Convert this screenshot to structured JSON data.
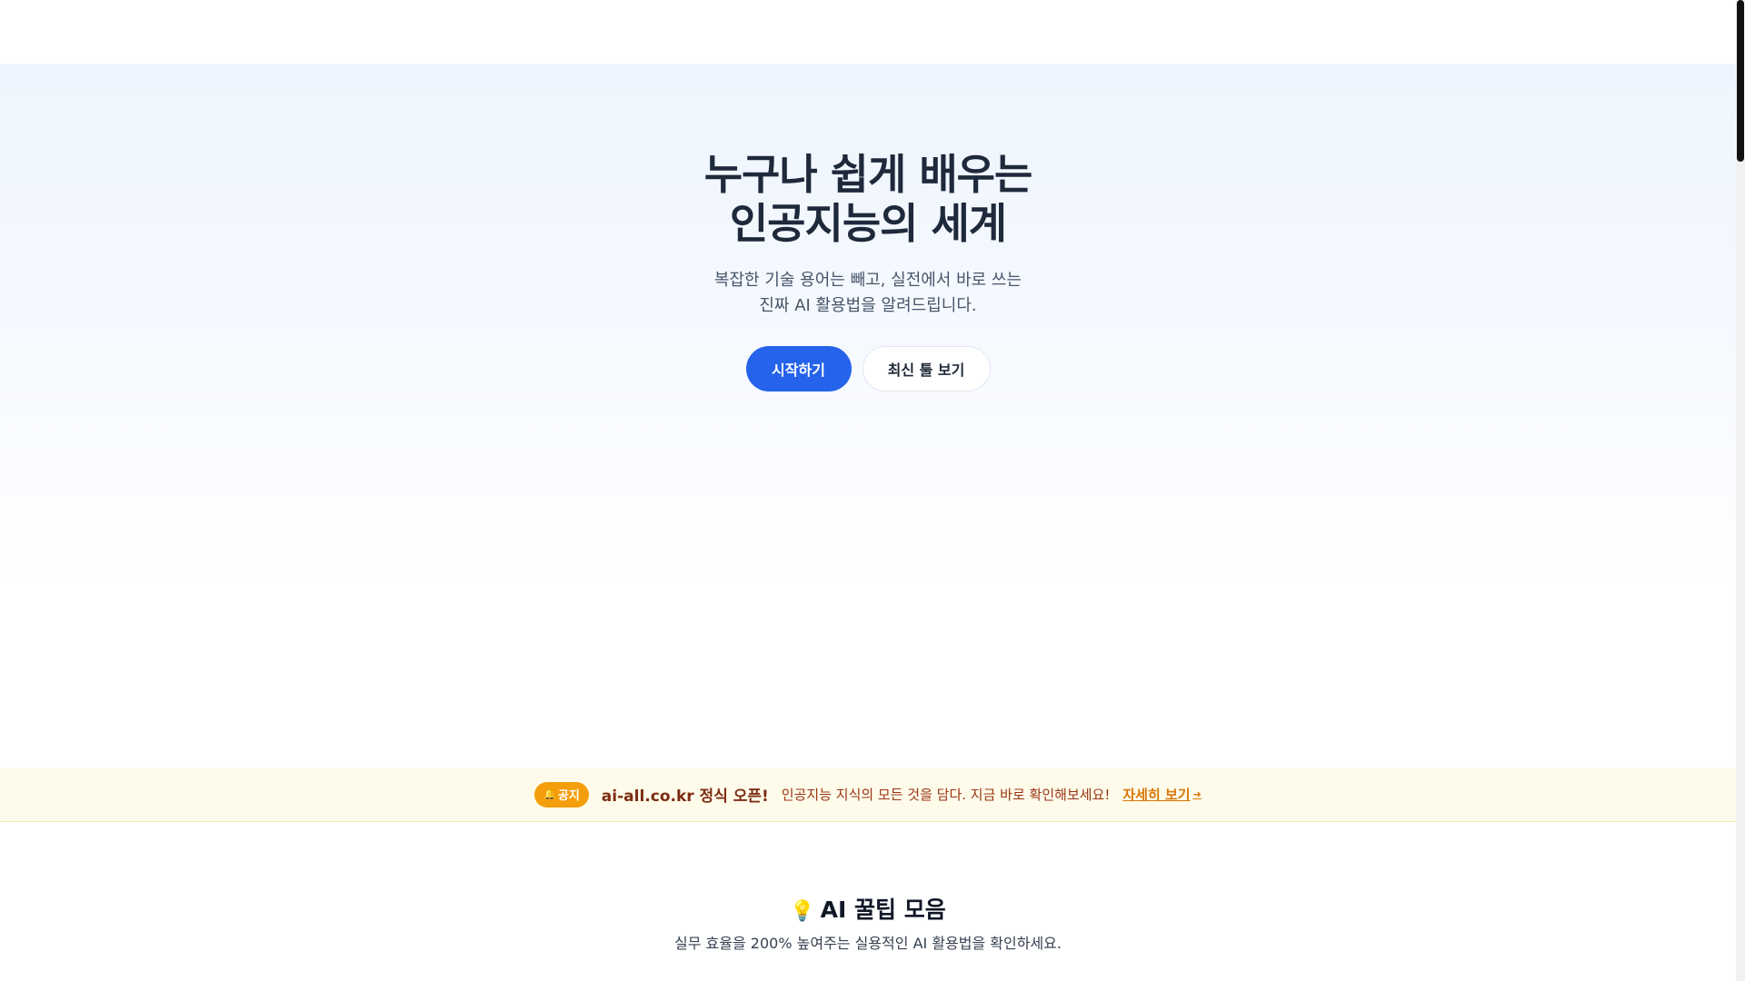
{
  "hero": {
    "title_line1": "누구나 쉽게 배우는",
    "title_line2": "인공지능의 세계",
    "subtitle_line1": "복잡한 기술 용어는 빼고, 실전에서 바로 쓰는",
    "subtitle_line2": "진짜 AI 활용법을 알려드립니다.",
    "primary_button": "시작하기",
    "secondary_button": "최신 툴 보기"
  },
  "notice": {
    "badge_icon": "bell-icon",
    "badge_label": "공지",
    "title": "ai-all.co.kr 정식 오픈!",
    "text": "인공지능 지식의 모든 것을 담다. 지금 바로 확인해보세요!",
    "link_label": "자세히 보기",
    "link_icon": "arrow-right-icon",
    "colors": {
      "background": "#fefbea",
      "badge": "#f59e0b",
      "title": "#7c2d12",
      "link": "#d97706"
    }
  },
  "tips": {
    "icon": "lightbulb-icon",
    "title": "AI 꿀팁 모음",
    "subtitle": "실무 효율을 200% 높여주는 실용적인 AI 활용법을 확인하세요."
  },
  "colors": {
    "primary": "#2563eb",
    "hero_gradient_top": "#eef5fe"
  }
}
